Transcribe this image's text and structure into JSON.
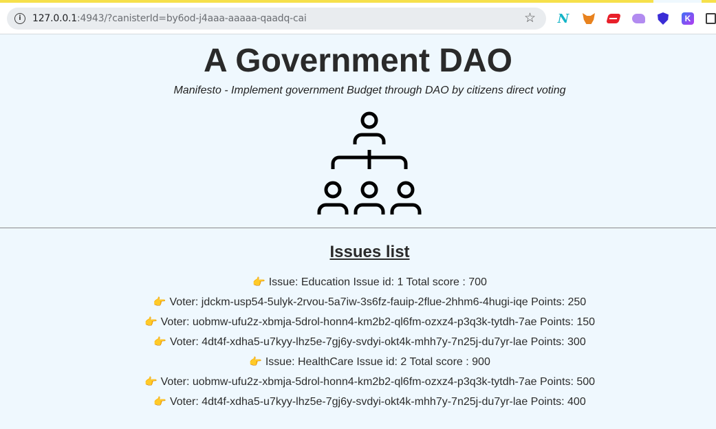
{
  "browser": {
    "url_host": "127.0.0.1",
    "url_rest": ":4943/?canisterId=by6od-j4aaa-aaaaa-qaadq-cai",
    "site_info_icon": "info-icon",
    "bookmark_icon": "star-icon",
    "extension_n_label": "N",
    "extension_k_label": "K",
    "extensions": [
      "n-extension-icon",
      "metamask-fox-icon",
      "red-wallet-icon",
      "ghost-wallet-icon",
      "shield-extension-icon",
      "k-extension-icon",
      "puzzle-extensions-icon"
    ]
  },
  "page": {
    "title": "A Government DAO",
    "subtitle": "Manifesto - Implement government Budget through DAO by citizens direct voting",
    "logo_icon": "organization-hierarchy-icon",
    "issues_heading": "Issues list",
    "pointer_glyph": "👉",
    "issues": [
      "Issue: Education Issue id: 1 Total score : 700",
      "Voter: jdckm-usp54-5ulyk-2rvou-5a7iw-3s6fz-fauip-2flue-2hhm6-4hugi-iqe Points: 250",
      "Voter: uobmw-ufu2z-xbmja-5drol-honn4-km2b2-ql6fm-ozxz4-p3q3k-tytdh-7ae Points: 150",
      "Voter: 4dt4f-xdha5-u7kyy-lhz5e-7gj6y-svdyi-okt4k-mhh7y-7n25j-du7yr-lae Points: 300",
      "Issue: HealthCare Issue id: 2 Total score : 900",
      "Voter: uobmw-ufu2z-xbmja-5drol-honn4-km2b2-ql6fm-ozxz4-p3q3k-tytdh-7ae Points: 500",
      "Voter: 4dt4f-xdha5-u7kyy-lhz5e-7gj6y-svdyi-okt4k-mhh7y-7n25j-du7yr-lae Points: 400"
    ]
  },
  "colors": {
    "page_background": "#eff8fe",
    "accent_bar": "#f6e04b"
  }
}
